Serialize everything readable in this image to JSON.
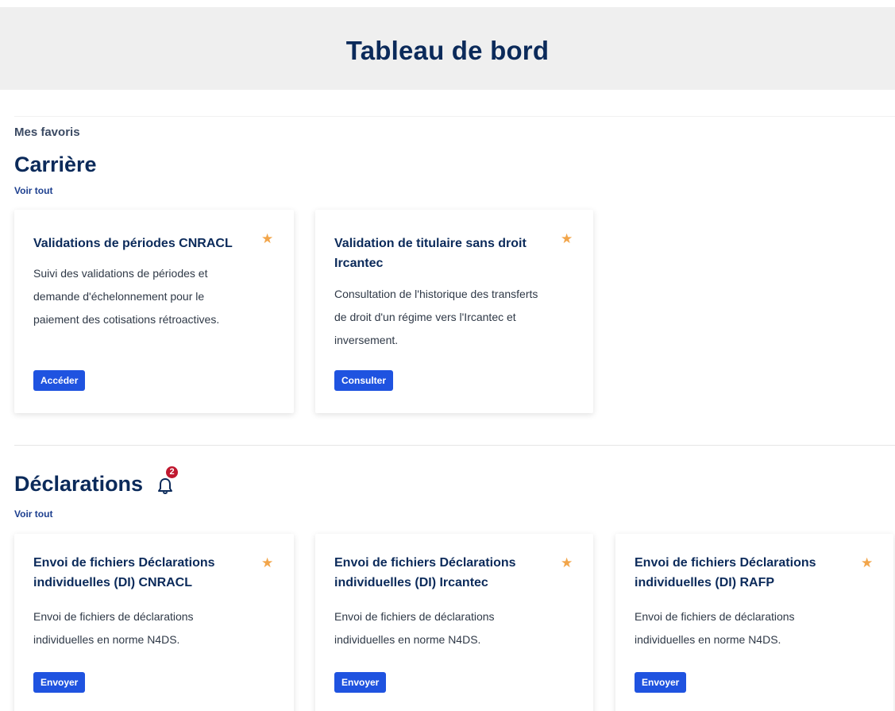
{
  "header": {
    "title": "Tableau de bord"
  },
  "favorites": {
    "label": "Mes favoris"
  },
  "career": {
    "title": "Carrière",
    "see_all": "Voir tout",
    "cards": [
      {
        "title_lines": [
          "Validations de périodes CNRACL"
        ],
        "description_lines": [
          "Suivi des validations de périodes et",
          "demande d'échelonnement pour le",
          "paiement des cotisations rétroactives."
        ],
        "button_label": "Accéder",
        "favorite": true
      },
      {
        "title_lines": [
          "Validation de titulaire sans droit",
          "Ircantec"
        ],
        "description_lines": [
          "Consultation de l'historique des transferts",
          "de droit d'un régime vers l'Ircantec et",
          "inversement."
        ],
        "button_label": "Consulter",
        "favorite": true
      }
    ]
  },
  "declarations": {
    "title": "Déclarations",
    "see_all": "Voir tout",
    "notification_count": "2",
    "cards": [
      {
        "title_lines": [
          "Envoi de fichiers Déclarations",
          "individuelles (DI) CNRACL"
        ],
        "description_lines": [
          "Envoi de fichiers de déclarations",
          "individuelles en norme N4DS."
        ],
        "button_label": "Envoyer",
        "favorite": true
      },
      {
        "title_lines": [
          "Envoi de fichiers Déclarations",
          "individuelles (DI) Ircantec"
        ],
        "description_lines": [
          "Envoi de fichiers de déclarations",
          "individuelles en norme N4DS."
        ],
        "button_label": "Envoyer",
        "favorite": true
      },
      {
        "title_lines": [
          "Envoi de fichiers Déclarations",
          "individuelles (DI) RAFP"
        ],
        "description_lines": [
          "Envoi de fichiers de déclarations",
          "individuelles en norme N4DS."
        ],
        "button_label": "Envoyer",
        "favorite": true
      }
    ]
  },
  "colors": {
    "header_bg": "#efefef",
    "title_navy": "#0b2a5a",
    "button_blue": "#1f53e0",
    "star_orange": "#f2a54a",
    "badge_red": "#c0182f"
  },
  "icons": {
    "favorite": "star-icon",
    "notifications": "bell-icon"
  }
}
